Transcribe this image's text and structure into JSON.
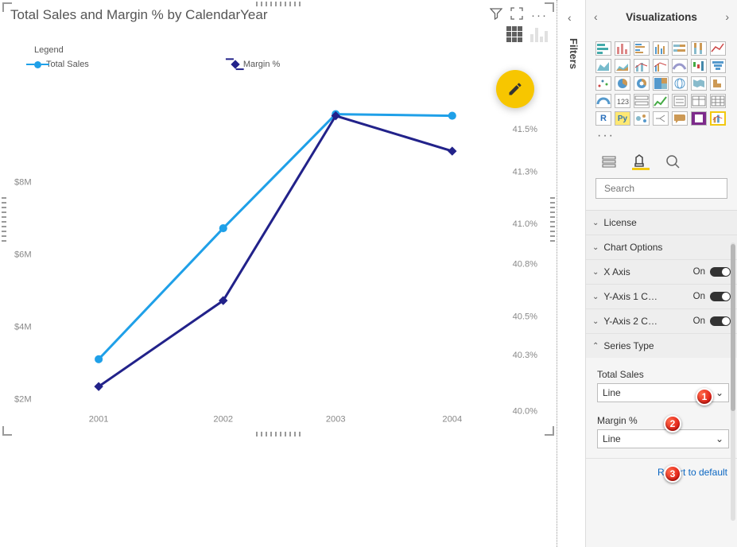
{
  "chart": {
    "title": "Total Sales and Margin % by CalendarYear",
    "legend_title": "Legend",
    "legend": {
      "s1": "Total Sales",
      "s2": "Margin %"
    },
    "y1_ticks": [
      "$8M",
      "$6M",
      "$4M",
      "$2M"
    ],
    "y2_ticks": [
      "41.5%",
      "41.3%",
      "41.0%",
      "40.8%",
      "40.5%",
      "40.3%",
      "40.0%"
    ],
    "x_ticks": [
      "2001",
      "2002",
      "2003",
      "2004"
    ]
  },
  "chart_data": {
    "type": "line",
    "categories": [
      "2001",
      "2002",
      "2003",
      "2004"
    ],
    "series": [
      {
        "name": "Total Sales",
        "axis": "y1",
        "values": [
          3300000,
          6560000,
          9400000,
          9350000
        ],
        "color": "#1fa0e8"
      },
      {
        "name": "Margin %",
        "axis": "y2",
        "values": [
          0.4013,
          0.4059,
          0.4157,
          0.4138
        ],
        "color": "#22228a"
      }
    ],
    "y1": {
      "label": "",
      "lim": [
        2000000,
        9500000
      ],
      "ticks": [
        2000000,
        4000000,
        6000000,
        8000000
      ]
    },
    "y2": {
      "label": "",
      "lim": [
        0.4,
        0.416
      ],
      "ticks": [
        0.4,
        0.403,
        0.405,
        0.408,
        0.41,
        0.413,
        0.415
      ]
    },
    "xlabel": "",
    "title": "Total Sales and Margin % by CalendarYear"
  },
  "filters": {
    "label": "Filters"
  },
  "vis_pane": {
    "title": "Visualizations",
    "search_placeholder": "Search",
    "cards": {
      "license": "License",
      "chart_options": "Chart Options",
      "xaxis": "X Axis",
      "y1": "Y-Axis 1 C…",
      "y2": "Y-Axis 2 C…",
      "series_type": "Series Type",
      "on": "On"
    },
    "series": {
      "s1_label": "Total Sales",
      "s1_value": "Line",
      "s2_label": "Margin %",
      "s2_value": "Line"
    },
    "revert": "Revert to default"
  },
  "callouts": {
    "c1": "1",
    "c2": "2",
    "c3": "3"
  }
}
